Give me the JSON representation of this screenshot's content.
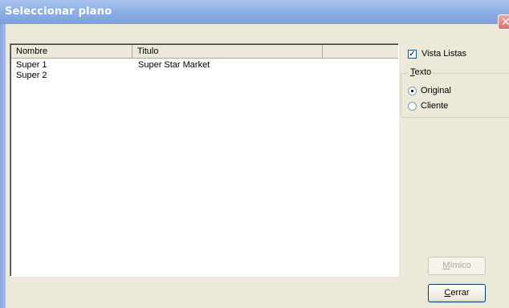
{
  "window": {
    "title": "Seleccionar plano",
    "close_glyph": "✕"
  },
  "list": {
    "columns": [
      "Nombre",
      "Titulo",
      ""
    ],
    "rows": [
      {
        "nombre": "Super 1",
        "titulo": "Super Star Market"
      },
      {
        "nombre": "Super 2",
        "titulo": ""
      }
    ]
  },
  "options": {
    "vista_listas": {
      "label": "Vista Listas",
      "checked": true
    },
    "texto_group": {
      "legend_mnemonic": "T",
      "legend_rest": "exto",
      "original": {
        "label": "Original",
        "selected": true
      },
      "cliente": {
        "label": "Cliente",
        "selected": false
      }
    }
  },
  "buttons": {
    "mimico": {
      "mnemonic": "M",
      "rest": "ímico",
      "enabled": false
    },
    "cerrar": {
      "mnemonic": "C",
      "rest": "errar",
      "enabled": true
    }
  }
}
